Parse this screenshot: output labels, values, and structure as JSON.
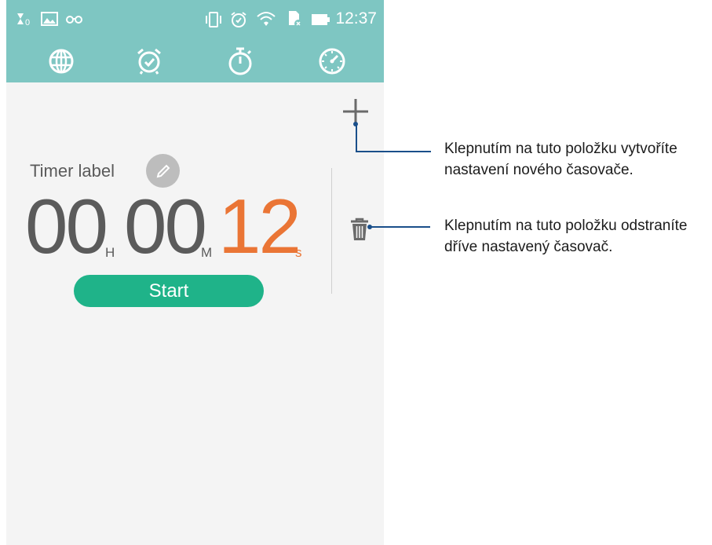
{
  "status_bar": {
    "time": "12:37",
    "left_icons": [
      "hourglass-icon",
      "image-icon",
      "glasses-icon"
    ],
    "right_icons": [
      "vibrate-icon",
      "alarm-icon",
      "wifi-icon",
      "sd-card-icon",
      "battery-icon"
    ]
  },
  "tabs": [
    {
      "name": "world-clock",
      "icon": "globe-icon"
    },
    {
      "name": "alarm",
      "icon": "alarm-clock-icon"
    },
    {
      "name": "stopwatch",
      "icon": "stopwatch-icon"
    },
    {
      "name": "timer",
      "icon": "timer-icon",
      "active": true
    }
  ],
  "timer": {
    "label": "Timer label",
    "hours": "00",
    "hours_unit": "H",
    "minutes": "00",
    "minutes_unit": "M",
    "seconds": "12",
    "seconds_unit": "s",
    "start_label": "Start"
  },
  "colors": {
    "header": "#7ec6c2",
    "start_button": "#1fb389",
    "seconds": "#ea7535",
    "callout": "#1a4f8a"
  },
  "callouts": {
    "add": "Klepnutím na tuto položku vytvoříte nastavení nového časovače.",
    "add_line1": "Klepnutím na tuto položku vytvoříte",
    "add_line2": "nastavení nového časovače.",
    "delete": "Klepnutím na tuto položku odstraníte dříve nastavený časovač.",
    "delete_line1": "Klepnutím na tuto položku odstraníte",
    "delete_line2": "dříve nastavený časovač."
  }
}
